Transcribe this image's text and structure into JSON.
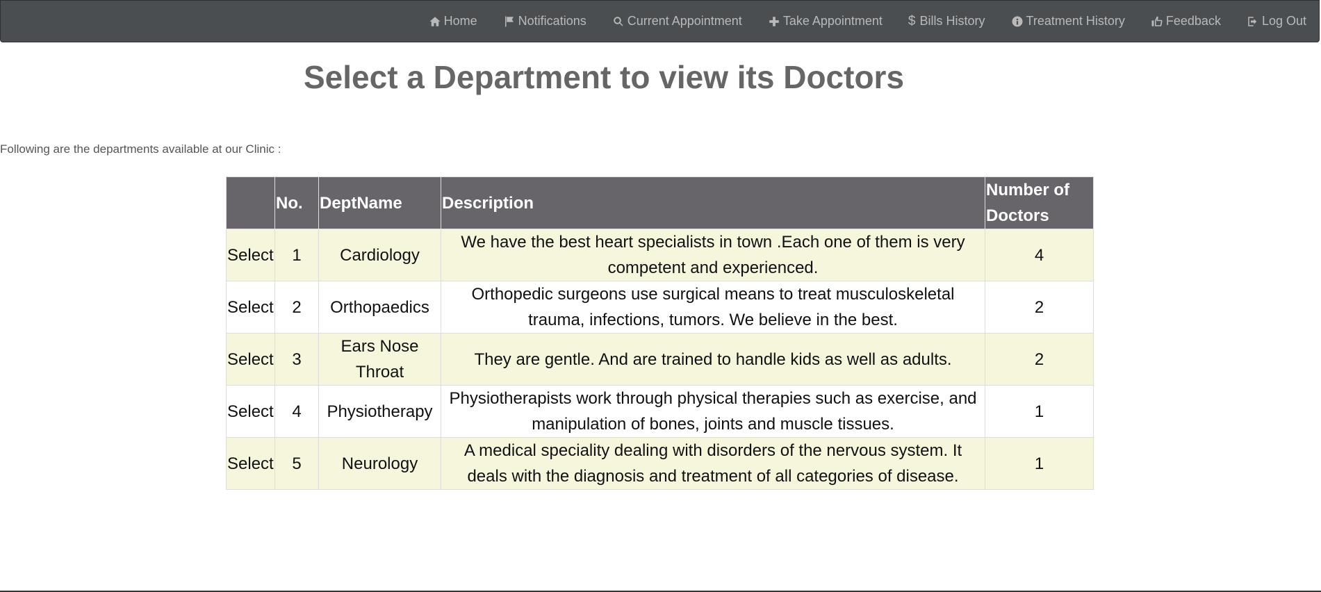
{
  "nav": [
    {
      "label": "Home",
      "icon": "home-icon"
    },
    {
      "label": "Notifications",
      "icon": "flag-icon"
    },
    {
      "label": "Current Appointment",
      "icon": "search-icon"
    },
    {
      "label": "Take Appointment",
      "icon": "plus-icon"
    },
    {
      "label": "Bills History",
      "icon": "dollar-icon"
    },
    {
      "label": "Treatment History",
      "icon": "info-icon"
    },
    {
      "label": "Feedback",
      "icon": "thumbs-up-icon"
    },
    {
      "label": "Log Out",
      "icon": "log-out-icon"
    }
  ],
  "page": {
    "title": "Select a Department to view its Doctors",
    "intro": "Following are the departments available at our Clinic :"
  },
  "table": {
    "headers": [
      "",
      "No.",
      "DeptName",
      "Description",
      "Number of Doctors"
    ],
    "select_label": "Select",
    "rows": [
      {
        "no": "1",
        "name": "Cardiology",
        "description": "We have the best heart specialists in town .Each one of them is very competent and experienced.",
        "doctors": "4"
      },
      {
        "no": "2",
        "name": "Orthopaedics",
        "description": "Orthopedic surgeons use surgical means to treat musculoskeletal trauma, infections, tumors. We believe in the best.",
        "doctors": "2"
      },
      {
        "no": "3",
        "name": "Ears Nose Throat",
        "description": "They are gentle. And are trained to handle kids as well as adults.",
        "doctors": "2"
      },
      {
        "no": "4",
        "name": "Physiotherapy",
        "description": "Physiotherapists work through physical therapies such as exercise, and manipulation of bones, joints and muscle tissues.",
        "doctors": "1"
      },
      {
        "no": "5",
        "name": "Neurology",
        "description": "A medical speciality dealing with disorders of the nervous system. It deals with the diagnosis and treatment of all categories of disease.",
        "doctors": "1"
      }
    ]
  },
  "colors": {
    "navbar": "#4b4e51",
    "header": "#676569",
    "row_odd": "#f6f6dd",
    "row_even": "#ffffff",
    "title": "#666666"
  }
}
